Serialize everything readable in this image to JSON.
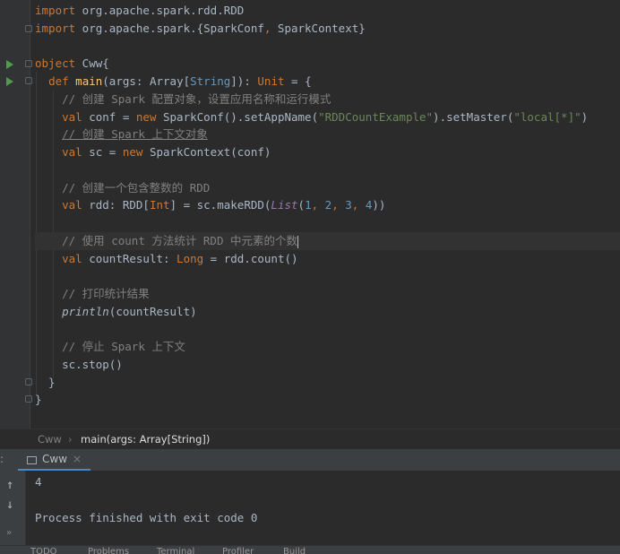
{
  "editor": {
    "lines": [
      "import org.apache.spark.rdd.RDD",
      "import org.apache.spark.{SparkConf, SparkContext}",
      "",
      "object Cww{",
      "  def main(args: Array[String]): Unit = {",
      "    // 创建 Spark 配置对象，设置应用名称和运行模式",
      "    val conf = new SparkConf().setAppName(\"RDDCountExample\").setMaster(\"local[*]\")",
      "    // 创建 Spark 上下文对象",
      "    val sc = new SparkContext(conf)",
      "",
      "    // 创建一个包含整数的 RDD",
      "    val rdd: RDD[Int] = sc.makeRDD(List(1, 2, 3, 4))",
      "",
      "    // 使用 count 方法统计 RDD 中元素的个数",
      "    val countResult: Long = rdd.count()",
      "",
      "    // 打印统计结果",
      "    println(countResult)",
      "",
      "    // 停止 Spark 上下文",
      "    sc.stop()",
      "  }",
      "}"
    ]
  },
  "breadcrumb": {
    "object": "Cww",
    "sep": "›",
    "method": "main(args: Array[String])"
  },
  "run": {
    "tab_label": "Cww",
    "close": "×",
    "output_value": "4",
    "finish_message": "Process finished with exit code 0"
  },
  "statusbar": {
    "items": [
      "TODO",
      "Problems",
      "Terminal",
      "Profiler",
      "Build"
    ]
  },
  "colors": {
    "keyword": "#cc7832",
    "string": "#6a8759",
    "number": "#6897bb",
    "comment": "#808080",
    "function": "#ffc66d",
    "background": "#2b2b2b"
  }
}
